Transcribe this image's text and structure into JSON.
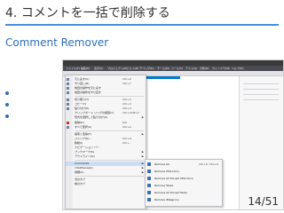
{
  "slide": {
    "title": "4. コメントを一括で削除する",
    "section": "Comment Remover",
    "page": "14/51"
  },
  "window": {
    "menubar": [
      "ファイル(F)",
      "編集(E)",
      "表示(V)",
      "プロジェクト(P)",
      "ビルド(B)",
      "デバッグ(D)",
      "チーム(M)",
      "ツール(T)",
      "テスト(S)",
      "分析(N)",
      "ウィンドウ(W)",
      "ヘルプ(H)"
    ]
  },
  "edit_menu": {
    "items": [
      {
        "label": "元に戻す(U)",
        "shortcut": "Ctrl+Z"
      },
      {
        "label": "やり直し(R)",
        "shortcut": "Ctrl+Y"
      },
      {
        "label": "前回の操作を元に戻す",
        "shortcut": ""
      },
      {
        "label": "前回の操作をやり直す",
        "shortcut": ""
      },
      {
        "label": "切り取り(T)",
        "shortcut": "Ctrl+X"
      },
      {
        "label": "コピー(Y)",
        "shortcut": "Ctrl+C"
      },
      {
        "label": "貼り付け(P)",
        "shortcut": "Ctrl+V"
      },
      {
        "label": "クリップボード リングの循環(Y)",
        "shortcut": "Ctrl+Shift+V"
      },
      {
        "label": "形式を選択して貼り付け(S)",
        "shortcut": ""
      },
      {
        "label": "削除(D)",
        "shortcut": "Del"
      },
      {
        "label": "すべて選択(A)",
        "shortcut": "Ctrl+A"
      },
      {
        "label": "検索と置換(F)",
        "shortcut": ""
      },
      {
        "label": "ジャンプ(G)...",
        "shortcut": "Ctrl+G"
      },
      {
        "label": "移動(I)",
        "shortcut": "Ctrl+,"
      },
      {
        "label": "ナビゲーション バー",
        "shortcut": ""
      },
      {
        "label": "ブックマーク(K)",
        "shortcut": ""
      },
      {
        "label": "アウトライン(O)",
        "shortcut": ""
      },
      {
        "label": "Comments",
        "shortcut": ""
      },
      {
        "label": "IntelliSense(I)",
        "shortcut": ""
      },
      {
        "label": "詳細(V)",
        "shortcut": ""
      },
      {
        "label": "次のタブ",
        "shortcut": ""
      },
      {
        "label": "前のタブ",
        "shortcut": ""
      }
    ]
  },
  "comments_submenu": {
    "items": [
      {
        "label": "Remove All",
        "shortcut": "Ctrl+K, Ctrl+Q"
      },
      {
        "label": "Remove XML Docs",
        "shortcut": ""
      },
      {
        "label": "Remove All Except XML Docs",
        "shortcut": ""
      },
      {
        "label": "Remove Tasks",
        "shortcut": ""
      },
      {
        "label": "Remove All Except Tasks",
        "shortcut": ""
      },
      {
        "label": "Remove #Regions",
        "shortcut": ""
      }
    ]
  }
}
